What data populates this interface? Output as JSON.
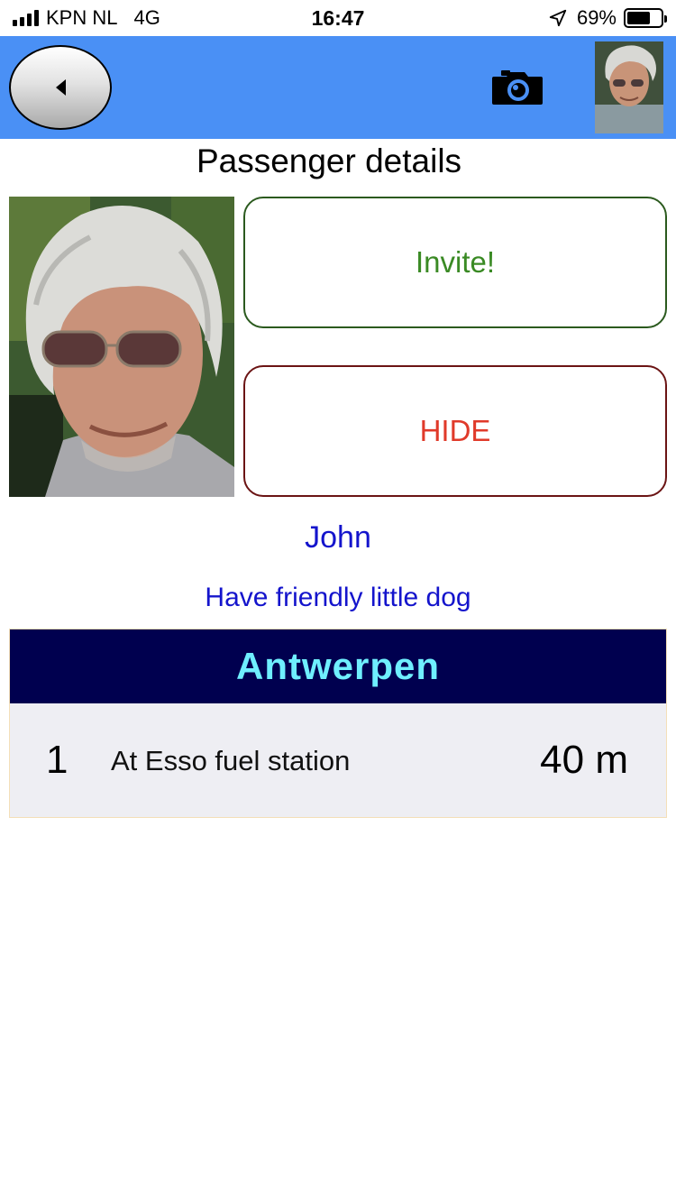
{
  "status_bar": {
    "carrier": "KPN NL",
    "network": "4G",
    "time": "16:47",
    "battery_percent": "69%",
    "battery_level": 0.69,
    "icons": [
      "signal-icon",
      "location-arrow-icon",
      "battery-icon"
    ]
  },
  "nav_bar": {
    "background": "#4a90f5",
    "icons": [
      "back-arrow-icon",
      "camera-icon"
    ]
  },
  "page": {
    "title": "Passenger details"
  },
  "actions": {
    "invite_label": "Invite!",
    "hide_label": "HIDE",
    "invite_color": "#3a8a24",
    "hide_color": "#e03a2a"
  },
  "passenger": {
    "name": "John",
    "note": "Have friendly little dog"
  },
  "stops": {
    "city": "Antwerpen",
    "header_bg": "#00004f",
    "header_color": "#6fefff",
    "rows": [
      {
        "number": "1",
        "name": "At Esso fuel station",
        "distance": "40 m"
      }
    ]
  }
}
